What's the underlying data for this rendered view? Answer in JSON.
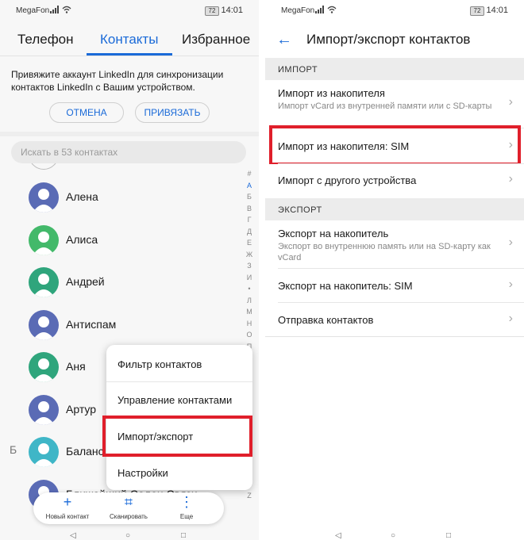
{
  "status_left": {
    "carrier": "MegaFon",
    "battery": "72",
    "time": "14:01"
  },
  "status_right": {
    "carrier": "MegaFon",
    "battery": "72",
    "time": "14:01"
  },
  "tabs": [
    {
      "label": "Телефон",
      "active": false
    },
    {
      "label": "Контакты",
      "active": true
    },
    {
      "label": "Избранное",
      "active": false
    }
  ],
  "linkedin": {
    "text": "Привяжите аккаунт LinkedIn для синхронизации контактов LinkedIn с Вашим устройством.",
    "cancel_label": "ОТМЕНА",
    "bind_label": "ПРИВЯЗАТЬ"
  },
  "search": {
    "placeholder": "Искать в 53 контактах"
  },
  "contacts": [
    {
      "name": "Алена",
      "avatar_color": "#5a6bb5"
    },
    {
      "name": "Алиса",
      "avatar_color": "#43b96a"
    },
    {
      "name": "Андрей",
      "avatar_color": "#2fa57c"
    },
    {
      "name": "Антиспам",
      "avatar_color": "#5a6bb5"
    },
    {
      "name": "Аня",
      "avatar_color": "#2fa57c"
    },
    {
      "name": "Артур",
      "avatar_color": "#5a6bb5"
    },
    {
      "name": "Баланс",
      "avatar_color": "#3fb6c7"
    },
    {
      "name": "Ближайший Салон Связи",
      "avatar_color": "#5a6bb5"
    }
  ],
  "section_letter": "Б",
  "alpha_index": [
    "#",
    "А",
    "Б",
    "В",
    "Г",
    "Д",
    "Е",
    "Ж",
    "З",
    "И",
    "•",
    "Л",
    "М",
    "Н",
    "О",
    "П",
    "Z"
  ],
  "menu": {
    "items": [
      "Фильтр контактов",
      "Управление контактами",
      "Импорт/экспорт",
      "Настройки"
    ]
  },
  "bottom_bar": {
    "new_contact": "Новый контакт",
    "scan": "Сканировать",
    "more": "Еще"
  },
  "right": {
    "title": "Импорт/экспорт контактов",
    "import_header": "ИМПОРТ",
    "import_storage_title": "Импорт из накопителя",
    "import_storage_sub": "Импорт vCard из внутренней памяти или с SD-карты",
    "import_sim": "Импорт из накопителя: SIM",
    "import_device": "Импорт с другого устройства",
    "export_header": "ЭКСПОРТ",
    "export_storage_title": "Экспорт на накопитель",
    "export_storage_sub": "Экспорт во внутреннюю память или на SD-карту как vCard",
    "export_sim": "Экспорт на накопитель: SIM",
    "send_contacts": "Отправка контактов"
  },
  "colors": {
    "accent": "#1a6ad8",
    "highlight": "#e01f2b"
  }
}
